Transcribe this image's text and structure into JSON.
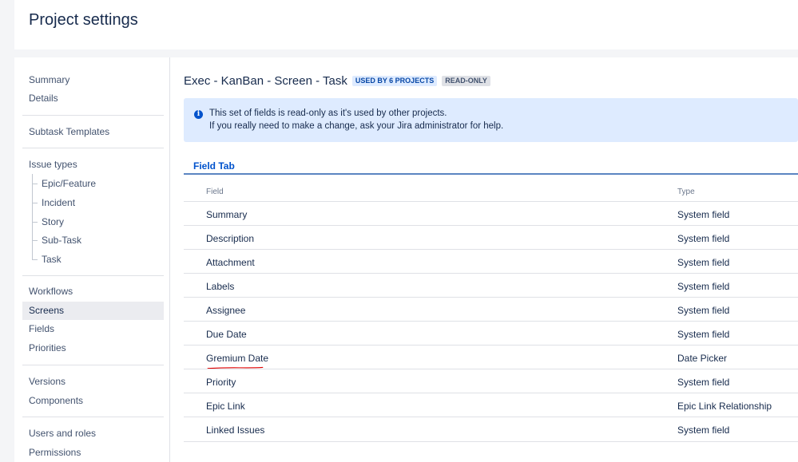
{
  "header": {
    "title": "Project settings"
  },
  "sidebar": {
    "group1": [
      "Summary",
      "Details"
    ],
    "group2": [
      "Subtask Templates"
    ],
    "issue_types": {
      "label": "Issue types",
      "children": [
        "Epic/Feature",
        "Incident",
        "Story",
        "Sub-Task",
        "Task"
      ]
    },
    "group4": [
      "Workflows",
      "Screens",
      "Fields",
      "Priorities"
    ],
    "active": "Screens",
    "group5": [
      "Versions",
      "Components"
    ],
    "group6": [
      "Users and roles",
      "Permissions"
    ]
  },
  "page": {
    "title": "Exec - KanBan - Screen - Task",
    "badge_used": "USED BY 6 PROJECTS",
    "badge_readonly": "READ-ONLY"
  },
  "info": {
    "icon": "info-icon",
    "line1": "This set of fields is read-only as it's used by other projects.",
    "line2": "If you really need to make a change, ask your Jira administrator for help."
  },
  "tab": {
    "label": "Field Tab"
  },
  "table": {
    "headers": {
      "field": "Field",
      "type": "Type"
    },
    "rows": [
      {
        "field": "Summary",
        "type": "System field"
      },
      {
        "field": "Description",
        "type": "System field"
      },
      {
        "field": "Attachment",
        "type": "System field"
      },
      {
        "field": "Labels",
        "type": "System field"
      },
      {
        "field": "Assignee",
        "type": "System field"
      },
      {
        "field": "Due Date",
        "type": "System field"
      },
      {
        "field": "Gremium Date",
        "type": "Date Picker"
      },
      {
        "field": "Priority",
        "type": "System field"
      },
      {
        "field": "Epic Link",
        "type": "Epic Link Relationship"
      },
      {
        "field": "Linked Issues",
        "type": "System field"
      }
    ]
  },
  "colors": {
    "accent": "#0052cc",
    "info_bg": "#deebff",
    "annotation": "#e00000"
  }
}
